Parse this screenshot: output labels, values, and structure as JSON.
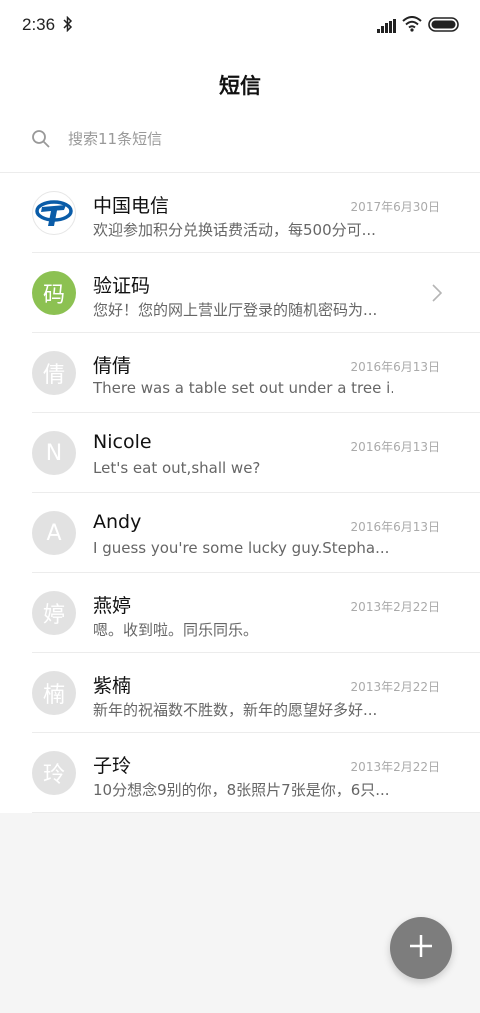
{
  "status": {
    "time": "2:36"
  },
  "header": {
    "title": "短信"
  },
  "search": {
    "placeholder": "搜索11条短信"
  },
  "conversations": [
    {
      "avatar": "",
      "name": "中国电信",
      "preview": "欢迎参加积分兑换话费活动，每500分可...",
      "date": "2017年6月30日"
    },
    {
      "avatar": "码",
      "name": "验证码",
      "preview": "您好！您的网上营业厅登录的随机密码为...",
      "date": ""
    },
    {
      "avatar": "倩",
      "name": "倩倩",
      "preview": "There was a table set out under a tree i...",
      "date": "2016年6月13日"
    },
    {
      "avatar": "N",
      "name": "Nicole",
      "preview": "Let's eat out,shall we?",
      "date": "2016年6月13日"
    },
    {
      "avatar": "A",
      "name": "Andy",
      "preview": "I guess you're some lucky guy.Stepha...",
      "date": "2016年6月13日"
    },
    {
      "avatar": "婷",
      "name": "燕婷",
      "preview": "嗯。收到啦。同乐同乐。",
      "date": "2013年2月22日"
    },
    {
      "avatar": "楠",
      "name": "紫楠",
      "preview": "新年的祝福数不胜数，新年的愿望好多好...",
      "date": "2013年2月22日"
    },
    {
      "avatar": "玲",
      "name": "子玲",
      "preview": "10分想念9别的你，8张照片7张是你，6只...",
      "date": "2013年2月22日"
    }
  ],
  "colors": {
    "verify_avatar": "#8cc152",
    "fab": "#7d7d7d",
    "telecom_blue": "#0a5ca8"
  },
  "icons": {
    "status": [
      "bluetooth-icon",
      "signal-icon",
      "wifi-icon",
      "battery-icon"
    ],
    "search": "search-icon",
    "fab": "plus-icon",
    "row_action": "chevron-right-icon"
  }
}
